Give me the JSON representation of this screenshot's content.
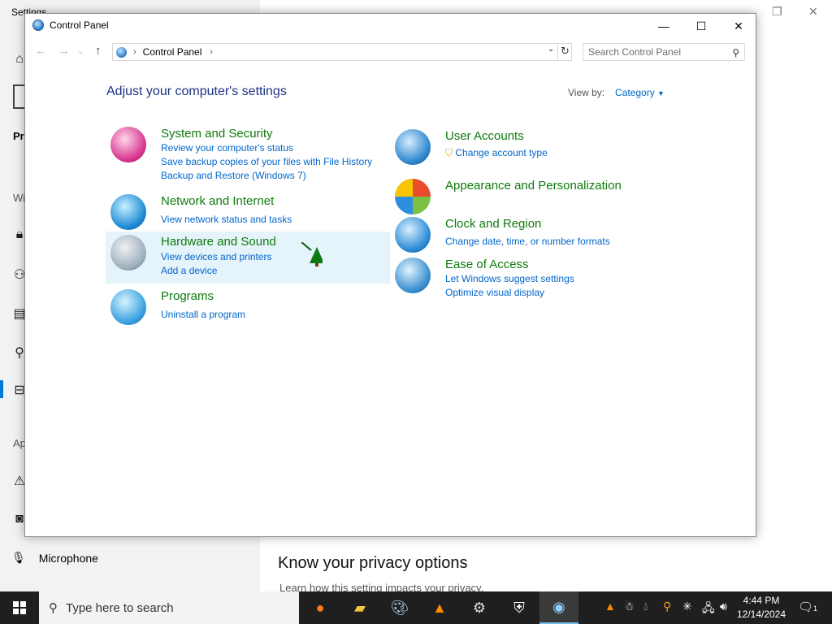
{
  "background": {
    "title": "Settings",
    "sidebar_fragments": [
      "Pri",
      "Wi",
      "Ap"
    ],
    "microphone_label": "Microphone",
    "heading": "Know your privacy options",
    "subtext": "Learn how this setting impacts your privacy."
  },
  "window": {
    "title": "Control Panel",
    "address_path": "Control Panel",
    "search_placeholder": "Search Control Panel",
    "heading": "Adjust your computer's settings",
    "view_by_label": "View by:",
    "view_by_value": "Category"
  },
  "categories": [
    {
      "title": "System and Security",
      "links": [
        "Review your computer's status",
        "Save backup copies of your files with File History",
        "Backup and Restore (Windows 7)"
      ]
    },
    {
      "title": "Network and Internet",
      "links": [
        "View network status and tasks"
      ]
    },
    {
      "title": "Hardware and Sound",
      "links": [
        "View devices and printers",
        "Add a device"
      ]
    },
    {
      "title": "Programs",
      "links": [
        "Uninstall a program"
      ]
    },
    {
      "title": "User Accounts",
      "links": [
        "Change account type"
      ]
    },
    {
      "title": "Appearance and Personalization",
      "links": []
    },
    {
      "title": "Clock and Region",
      "links": [
        "Change date, time, or number formats"
      ]
    },
    {
      "title": "Ease of Access",
      "links": [
        "Let Windows suggest settings",
        "Optimize visual display"
      ]
    }
  ],
  "taskbar": {
    "search_placeholder": "Type here to search",
    "time": "4:44 PM",
    "date": "12/14/2024",
    "notification_count": "1"
  }
}
